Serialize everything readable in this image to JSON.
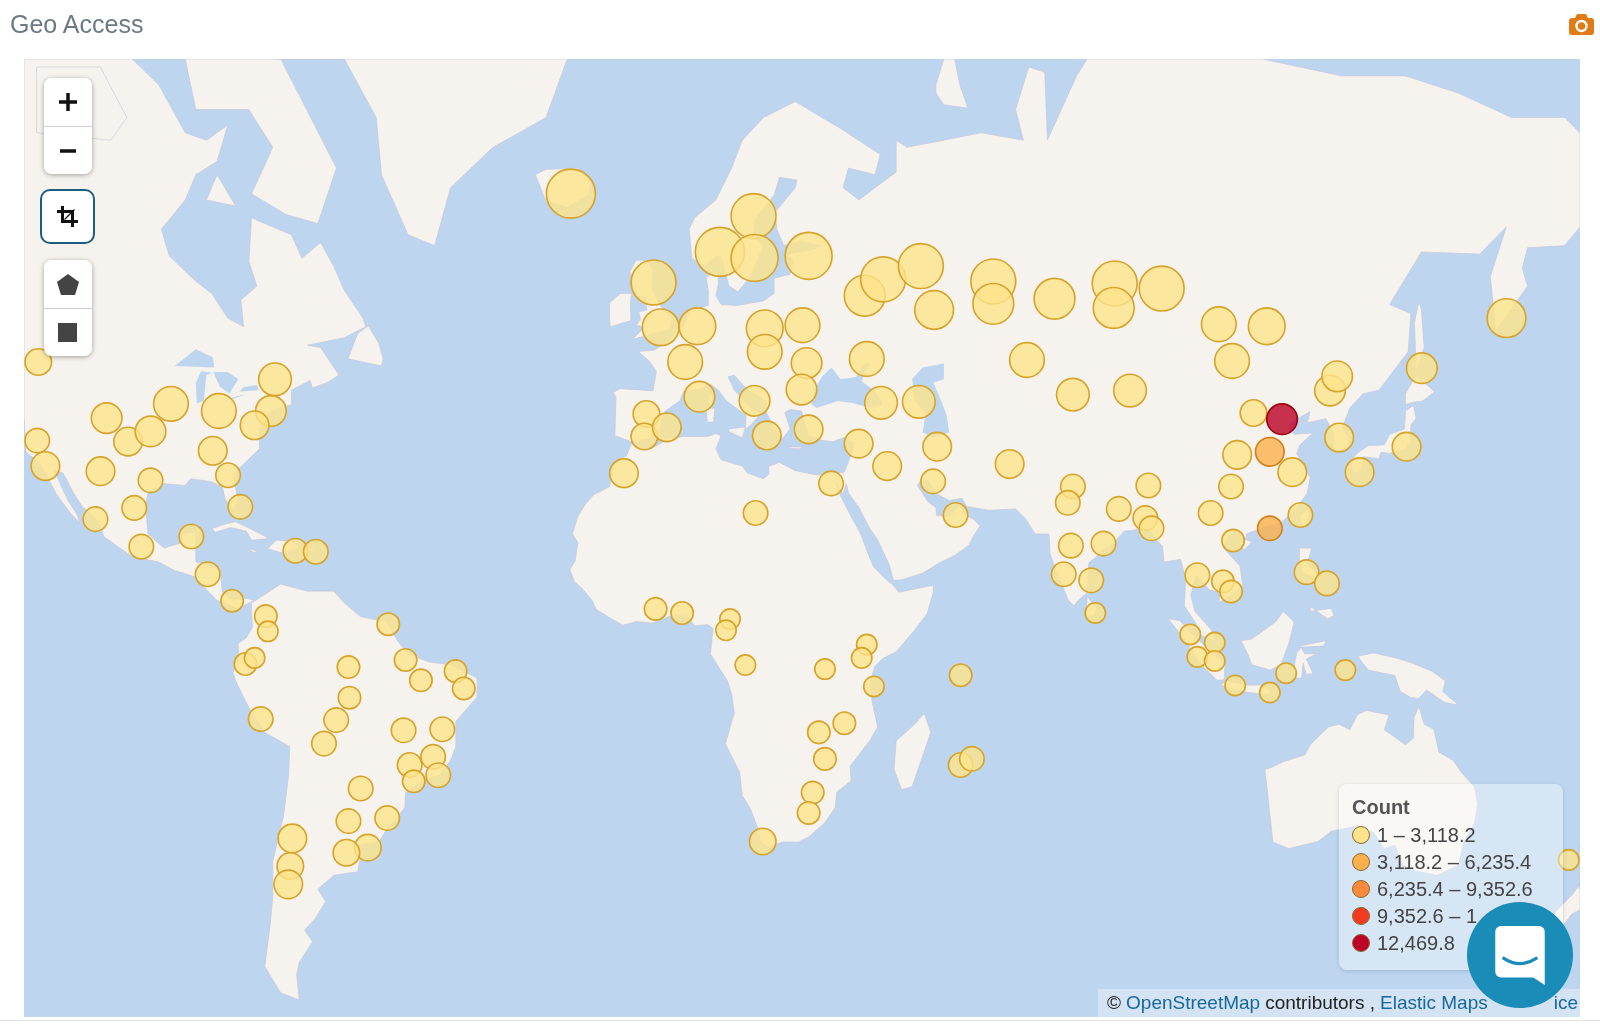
{
  "panel": {
    "title": "Geo Access"
  },
  "map": {
    "zoom_buttons": [
      {
        "kind": "zoom_in",
        "focused": false
      },
      {
        "kind": "zoom_out",
        "focused": false
      }
    ],
    "fit_button": {
      "focused": true
    },
    "draw_buttons": [
      {
        "kind": "polygon",
        "focused": false
      },
      {
        "kind": "rectangle",
        "focused": false
      }
    ],
    "legend": {
      "title": "Count",
      "items": [
        {
          "label": "1 – 3,118.2",
          "color": "#fee38b"
        },
        {
          "label": "3,118.2 – 6,235.4",
          "color": "#fdb04b"
        },
        {
          "label": "6,235.4 – 9,352.6",
          "color": "#fc8a3d"
        },
        {
          "label": "9,352.6 – 1",
          "color": "#f03b20"
        },
        {
          "label": "12,469.8",
          "color": "#bd0026"
        }
      ]
    },
    "attribution": {
      "parts": [
        {
          "kind": "text",
          "text": "©"
        },
        {
          "kind": "link",
          "text": "OpenStreetMap"
        },
        {
          "kind": "text",
          "text": "contributors ,"
        },
        {
          "kind": "link",
          "text": "Elastic Maps"
        }
      ],
      "tail": "ice"
    }
  }
}
